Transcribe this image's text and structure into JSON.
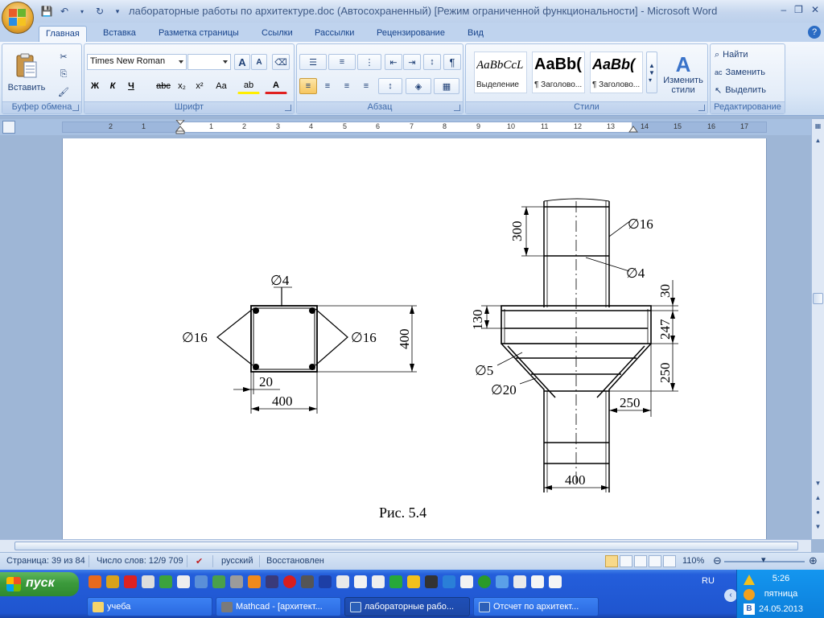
{
  "window": {
    "title": "лабораторные работы по архитектуре.doc (Автосохраненный) [Режим ограниченной функциональности] - Microsoft Word",
    "controls": [
      "–",
      "❐",
      "✕"
    ]
  },
  "tabs": [
    {
      "label": "Главная",
      "active": true
    },
    {
      "label": "Вставка"
    },
    {
      "label": "Разметка страницы"
    },
    {
      "label": "Ссылки"
    },
    {
      "label": "Рассылки"
    },
    {
      "label": "Рецензирование"
    },
    {
      "label": "Вид"
    }
  ],
  "help_label": "?",
  "ribbon": {
    "clipboard": {
      "label": "Буфер обмена",
      "paste": "Вставить"
    },
    "font": {
      "label": "Шрифт",
      "font_name": "Times New Roman",
      "font_size": "",
      "grow": "A",
      "shrink": "A",
      "bold": "Ж",
      "italic": "К",
      "underline": "Ч",
      "strike": "abc",
      "subscript": "x₂",
      "superscript": "x²",
      "case": "Aa",
      "highlight": "ab",
      "font_color": "A"
    },
    "paragraph": {
      "label": "Абзац",
      "pilcrow": "¶"
    },
    "styles": {
      "label": "Стили",
      "items": [
        {
          "sample": "AaBbCcL",
          "name": "Выделение"
        },
        {
          "sample": "AaBb(",
          "name": "¶ Заголово..."
        },
        {
          "sample": "AaBb(",
          "name": "¶ Заголово..."
        }
      ],
      "change_line1": "Изменить",
      "change_line2": "стили"
    },
    "editing": {
      "label": "Редактирование",
      "find": "Найти",
      "replace": "Заменить",
      "select": "Выделить"
    }
  },
  "ruler": {
    "left_numbers": [
      "2",
      "1"
    ],
    "right_numbers": [
      "1",
      "2",
      "3",
      "4",
      "5",
      "6",
      "7",
      "8",
      "9",
      "10",
      "11",
      "12",
      "13",
      "14",
      "15",
      "16",
      "17"
    ]
  },
  "drawing": {
    "left": {
      "phi4": "∅4",
      "phi16_left": "∅16",
      "phi16_right": "∅16",
      "dim_20": "20",
      "dim_400_h": "400",
      "dim_400_v": "400"
    },
    "right": {
      "phi16": "∅16",
      "phi4": "∅4",
      "dim_300": "300",
      "dim_30": "30",
      "dim_130": "130",
      "dim_247": "247",
      "dim_250_v": "250",
      "phi5": "∅5",
      "phi20": "∅20",
      "dim_250_h": "250",
      "dim_400": "400"
    },
    "caption": "Рис. 5.4"
  },
  "statusbar": {
    "page": "Страница: 39 из 84",
    "words": "Число слов: 12/9 709",
    "language": "русский",
    "state": "Восстановлен",
    "zoom": "110%"
  },
  "taskbar": {
    "start": "пуск",
    "language": "RU",
    "time": "5:26",
    "weekday": "пятница",
    "date": "24.05.2013",
    "tasks": [
      {
        "label": "учеба"
      },
      {
        "label": "Mathcad - [архитект..."
      },
      {
        "label": "лабораторные рабо...",
        "active": true
      },
      {
        "label": "Отсчет по архитект..."
      }
    ]
  }
}
